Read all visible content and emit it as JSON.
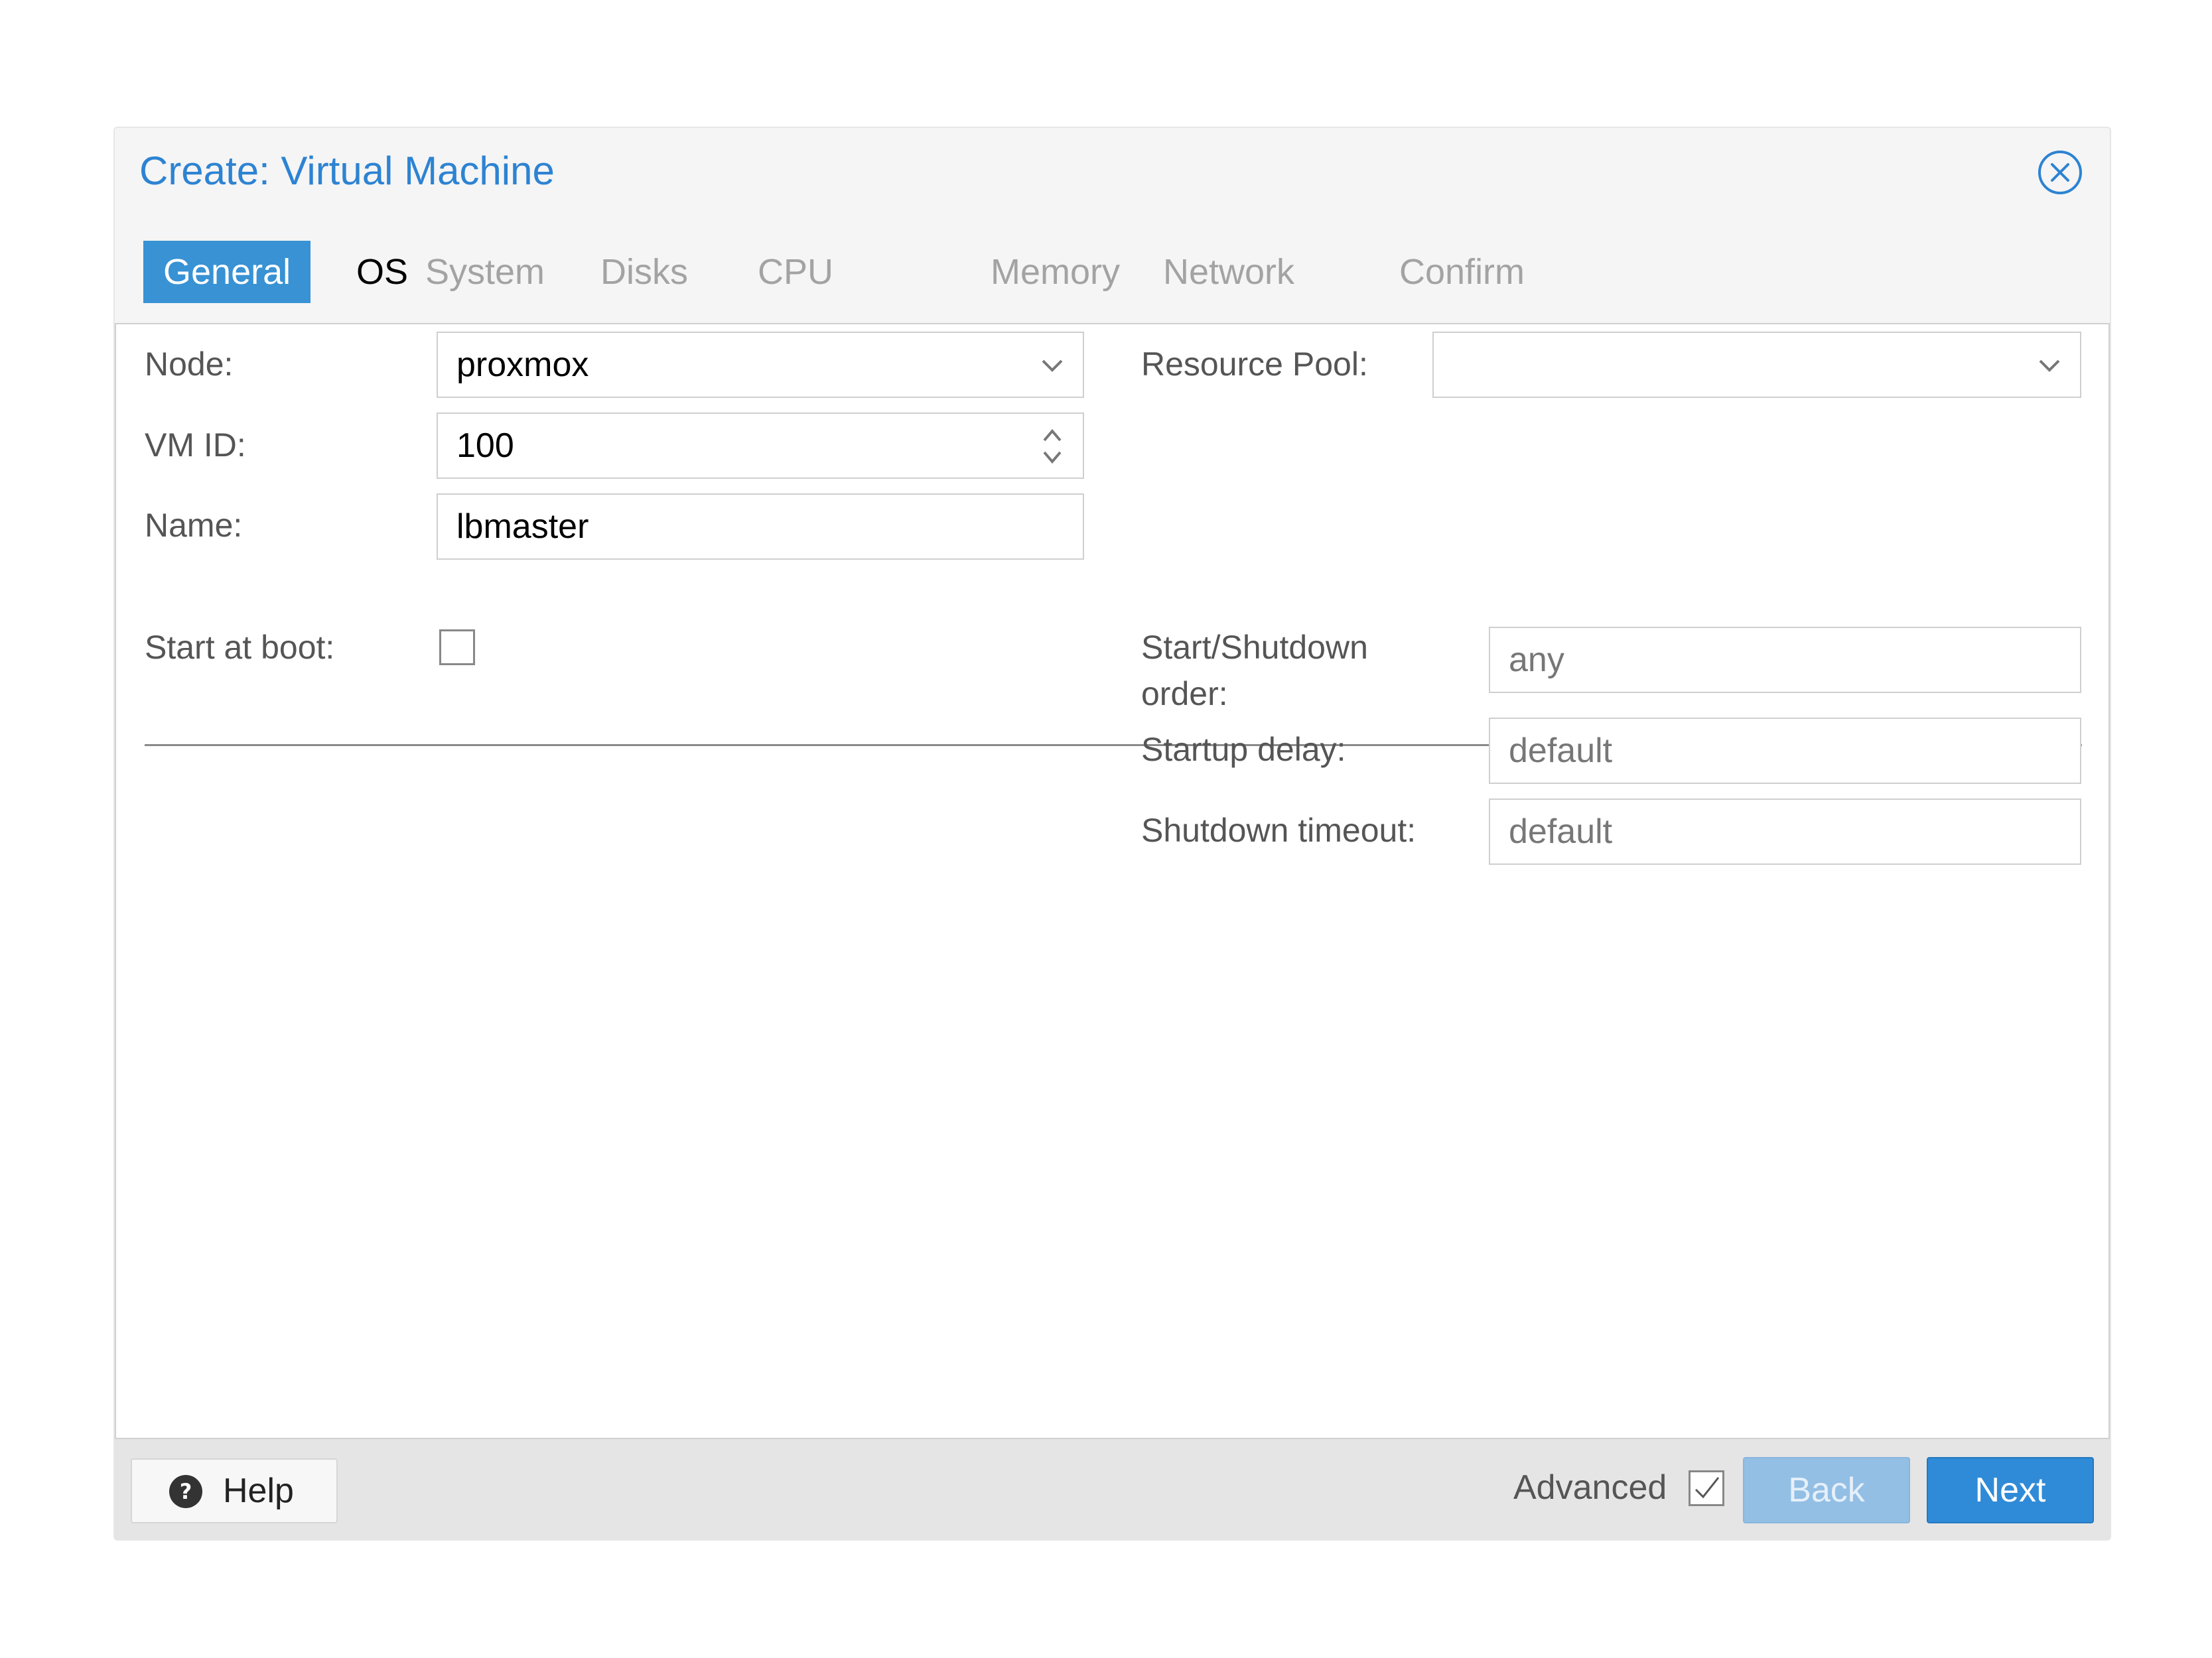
{
  "dialog": {
    "title": "Create: Virtual Machine",
    "close_icon": "close-circle-icon"
  },
  "tabs": [
    {
      "label": "General",
      "state": "active"
    },
    {
      "label": "OS",
      "state": "enabled"
    },
    {
      "label": "System",
      "state": "disabled"
    },
    {
      "label": "Disks",
      "state": "disabled"
    },
    {
      "label": "CPU",
      "state": "disabled"
    },
    {
      "label": "Memory",
      "state": "disabled"
    },
    {
      "label": "Network",
      "state": "disabled"
    },
    {
      "label": "Confirm",
      "state": "disabled"
    }
  ],
  "form": {
    "node": {
      "label": "Node:",
      "value": "proxmox"
    },
    "vmid": {
      "label": "VM ID:",
      "value": "100"
    },
    "name": {
      "label": "Name:",
      "value": "lbmaster"
    },
    "resource_pool": {
      "label": "Resource Pool:",
      "value": ""
    },
    "start_at_boot": {
      "label": "Start at boot:",
      "checked": false
    },
    "startup_order": {
      "label_line1": "Start/Shutdown",
      "label_line2": "order:",
      "placeholder": "any"
    },
    "startup_delay": {
      "label": "Startup delay:",
      "placeholder": "default"
    },
    "shutdown_timeout": {
      "label": "Shutdown timeout:",
      "placeholder": "default"
    }
  },
  "footer": {
    "help_label": "Help",
    "help_icon": "question-circle-icon",
    "advanced_label": "Advanced",
    "advanced_checked": true,
    "back_label": "Back",
    "next_label": "Next"
  },
  "colors": {
    "accent": "#3892d4",
    "title": "#2d83d2",
    "back_disabled": "#93bfe5"
  }
}
